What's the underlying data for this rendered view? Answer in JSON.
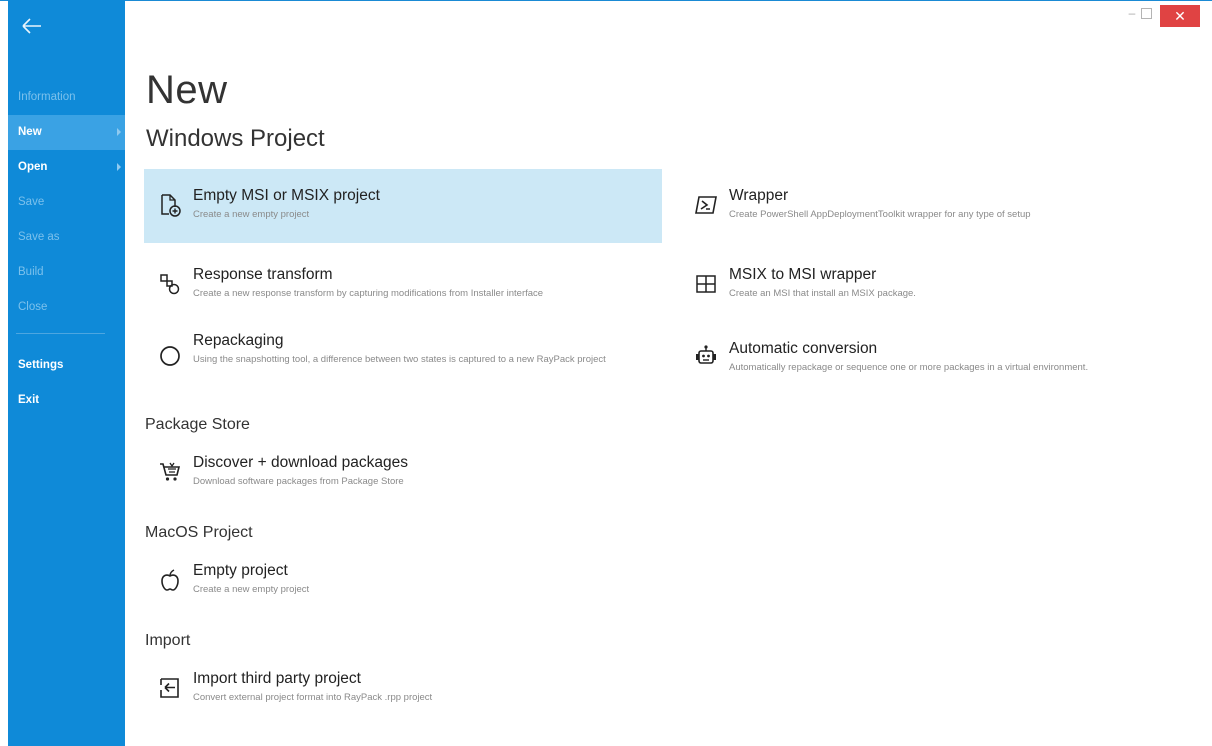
{
  "sidebar": {
    "back_icon": "arrow-left-icon",
    "items": [
      {
        "label": "Information"
      },
      {
        "label": "New"
      },
      {
        "label": "Open"
      },
      {
        "label": "Save"
      },
      {
        "label": "Save as"
      },
      {
        "label": "Build"
      },
      {
        "label": "Close"
      },
      {
        "label": "Settings"
      },
      {
        "label": "Exit"
      }
    ]
  },
  "window_controls": {
    "close_label": "✕",
    "minimize_label": "–"
  },
  "page": {
    "title": "New",
    "subtitle": "Windows Project"
  },
  "windows_project": {
    "left": [
      {
        "title": "Empty MSI or MSIX project",
        "desc": "Create a new empty project",
        "icon": "new-document-icon"
      },
      {
        "title": "Response transform",
        "desc": "Create a new response transform by capturing modifications from Installer interface",
        "icon": "transform-icon"
      },
      {
        "title": "Repackaging",
        "desc": "Using the snapshotting tool, a difference between two states is captured to a new RayPack project",
        "icon": "circle-icon"
      }
    ],
    "right": [
      {
        "title": "Wrapper",
        "desc": "Create PowerShell AppDeploymentToolkit wrapper for any type of setup",
        "icon": "powershell-icon"
      },
      {
        "title": "MSIX to MSI wrapper",
        "desc": "Create an MSI that install an MSIX package.",
        "icon": "windows-icon"
      },
      {
        "title": "Automatic conversion",
        "desc": "Automatically repackage or sequence one or more packages in a virtual environment.",
        "icon": "robot-icon"
      }
    ]
  },
  "package_store": {
    "heading": "Package Store",
    "item": {
      "title": "Discover + download packages",
      "desc": "Download software packages from Package Store",
      "icon": "shopping-cart-icon"
    }
  },
  "macos_project": {
    "heading": "MacOS Project",
    "item": {
      "title": "Empty project",
      "desc": "Create a new empty project",
      "icon": "apple-icon"
    }
  },
  "import": {
    "heading": "Import",
    "item": {
      "title": "Import third party project",
      "desc": "Convert external project format into RayPack .rpp project",
      "icon": "import-icon"
    }
  },
  "colors": {
    "sidebar": "#0f8ad8",
    "sidebar_active": "#3aa2e4",
    "selected_item": "#cce8f6",
    "close_button": "#e04343"
  }
}
